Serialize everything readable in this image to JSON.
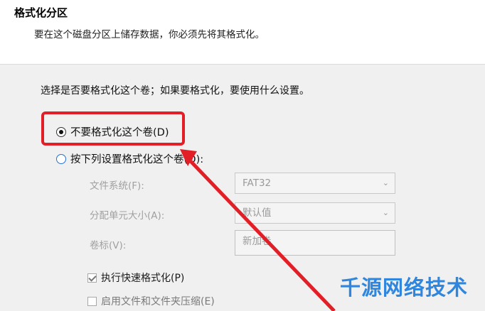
{
  "header": {
    "title": "格式化分区",
    "subtitle": "要在这个磁盘分区上储存数据，你必须先将其格式化。"
  },
  "prompt": "选择是否要格式化这个卷；如果要格式化，要使用什么设置。",
  "options": {
    "no_format": {
      "label": "不要格式化这个卷(D)",
      "selected": true
    },
    "format": {
      "label": "按下列设置格式化这个卷(O):",
      "selected": false
    }
  },
  "fields": {
    "filesystem": {
      "label": "文件系统(F):",
      "value": "FAT32"
    },
    "alloc_unit": {
      "label": "分配单元大小(A):",
      "value": "默认值"
    },
    "volume_label": {
      "label": "卷标(V):",
      "value": "新加卷"
    }
  },
  "checkboxes": {
    "quick_format": {
      "label": "执行快速格式化(P)",
      "checked": true
    },
    "compression": {
      "label": "启用文件和文件夹压缩(E)",
      "checked": false
    }
  },
  "watermark": "千源网络技术",
  "colors": {
    "highlight": "#e21f26",
    "watermark": "#2e86de",
    "radio_accent": "#1e73d6"
  },
  "icons": {
    "chevron": "chevron-down-icon",
    "arrow": "red-arrow-annotation"
  }
}
